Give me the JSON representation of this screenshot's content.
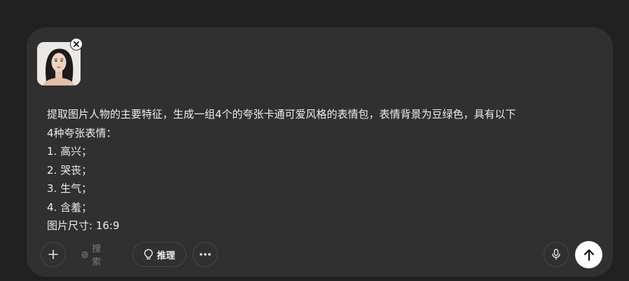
{
  "attachment": {
    "thumbnail_icon": "portrait-photo",
    "remove_icon": "close-icon"
  },
  "prompt": {
    "text": "提取图片人物的主要特征，生成一组4个的夸张卡通可爱风格的表情包，表情背景为豆绿色，具有以下\n4种夸张表情：\n1. 高兴；\n2. 哭丧；\n3. 生气；\n4. 含羞；\n图片尺寸: 16:9"
  },
  "toolbar": {
    "add_icon": "plus-icon",
    "search_label": "搜索",
    "search_icon": "globe-icon",
    "reason_label": "推理",
    "reason_icon": "lightbulb-icon",
    "more_icon": "ellipsis-icon",
    "mic_icon": "microphone-icon",
    "send_icon": "arrow-up-icon"
  },
  "colors": {
    "page_bg": "#212121",
    "composer_bg": "#303030",
    "text": "#ececec",
    "muted": "#7c7c7c",
    "send_bg": "#ffffff"
  }
}
